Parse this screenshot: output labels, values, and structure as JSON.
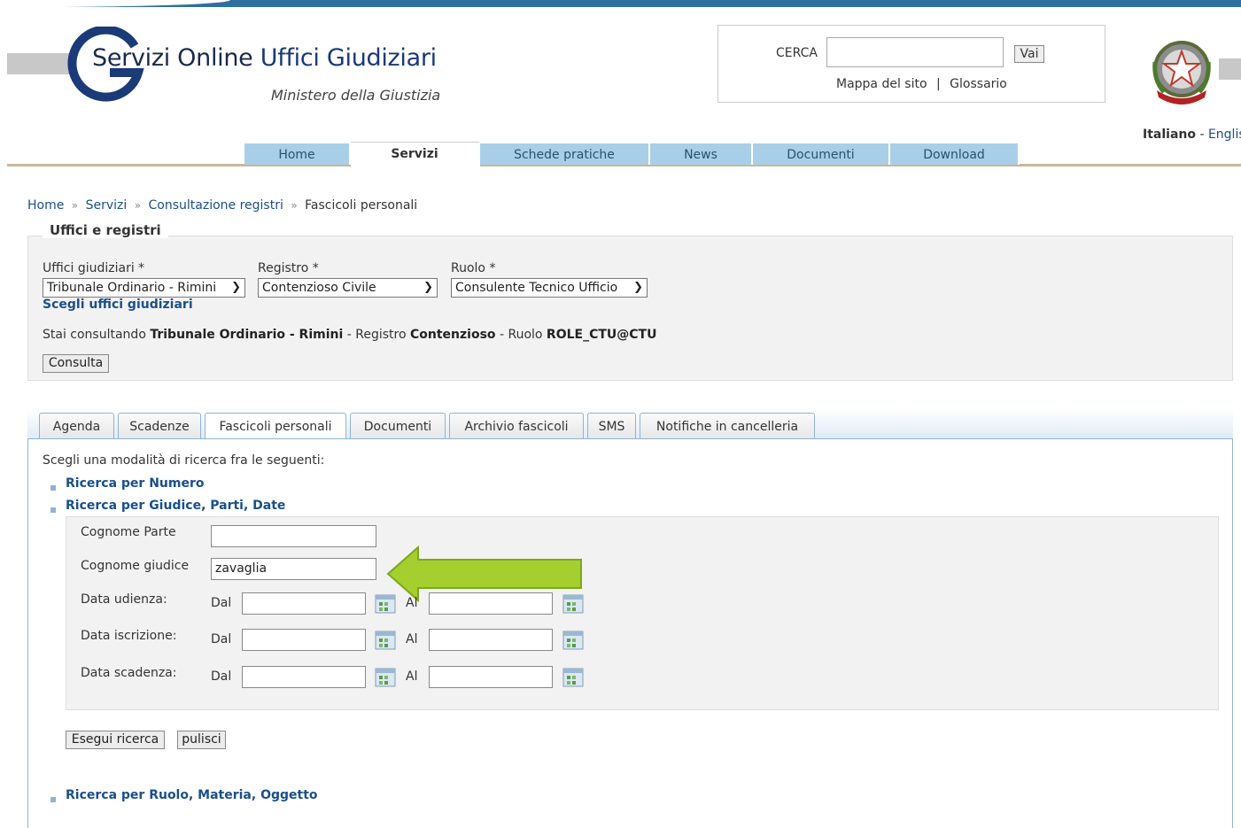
{
  "header": {
    "site_title_part1": "Servizi Online",
    "site_title_part2": "Uffici Giudiziari",
    "subtitle": "Ministero della Giustizia",
    "search_label": "CERCA",
    "search_value": "",
    "search_button": "Vai",
    "sitemap_link": "Mappa del sito",
    "separator": "|",
    "glossary_link": "Glossario",
    "lang_current": "Italiano",
    "lang_sep": "-",
    "lang_other": "Englis"
  },
  "nav": {
    "items": [
      {
        "label": "Home"
      },
      {
        "label": "Servizi"
      },
      {
        "label": "Schede pratiche"
      },
      {
        "label": "News"
      },
      {
        "label": "Documenti"
      },
      {
        "label": "Download"
      }
    ]
  },
  "breadcrumb": {
    "items": [
      "Home",
      "Servizi",
      "Consultazione registri",
      "Fascicoli personali"
    ],
    "separator": "»"
  },
  "offices": {
    "legend": "Uffici e registri",
    "office_label": "Uffici giudiziari *",
    "office_value": "Tribunale Ordinario - Rimini",
    "register_label": "Registro *",
    "register_value": "Contenzioso Civile",
    "role_label": "Ruolo *",
    "role_value": "Consulente Tecnico Ufficio",
    "choose_link": "Scegli uffici giudiziari",
    "consult_prefix": "Stai consultando",
    "consult_office": "Tribunale Ordinario - Rimini",
    "consult_register_prefix": "- Registro",
    "consult_register": "Contenzioso",
    "consult_role_prefix": "- Ruolo",
    "consult_role": "ROLE_CTU@CTU",
    "consult_button": "Consulta"
  },
  "tabs": {
    "items": [
      {
        "label": "Agenda"
      },
      {
        "label": "Scadenze"
      },
      {
        "label": "Fascicoli personali"
      },
      {
        "label": "Documenti"
      },
      {
        "label": "Archivio fascicoli"
      },
      {
        "label": "SMS"
      },
      {
        "label": "Notifiche in cancelleria"
      }
    ],
    "active": "Fascicoli personali"
  },
  "search": {
    "intro": "Scegli una modalità di ricerca fra le seguenti:",
    "mode_number": "Ricerca per Numero",
    "mode_judge": "Ricerca per Giudice, Parti, Date",
    "mode_role": "Ricerca per Ruolo, Materia, Oggetto",
    "party_label": "Cognome Parte",
    "party_value": "",
    "judge_label": "Cognome giudice",
    "judge_value": "zavaglia",
    "hearing_label": "Data udienza:",
    "registration_label": "Data iscrizione:",
    "deadline_label": "Data scadenza:",
    "from_label": "Dal",
    "to_label": "Al",
    "run_button": "Esegui ricerca",
    "clear_button": "pulisci"
  },
  "colors": {
    "link": "#1a4f8a",
    "nav_tab": "#a9cfe8",
    "arrow": "#9acd32"
  }
}
